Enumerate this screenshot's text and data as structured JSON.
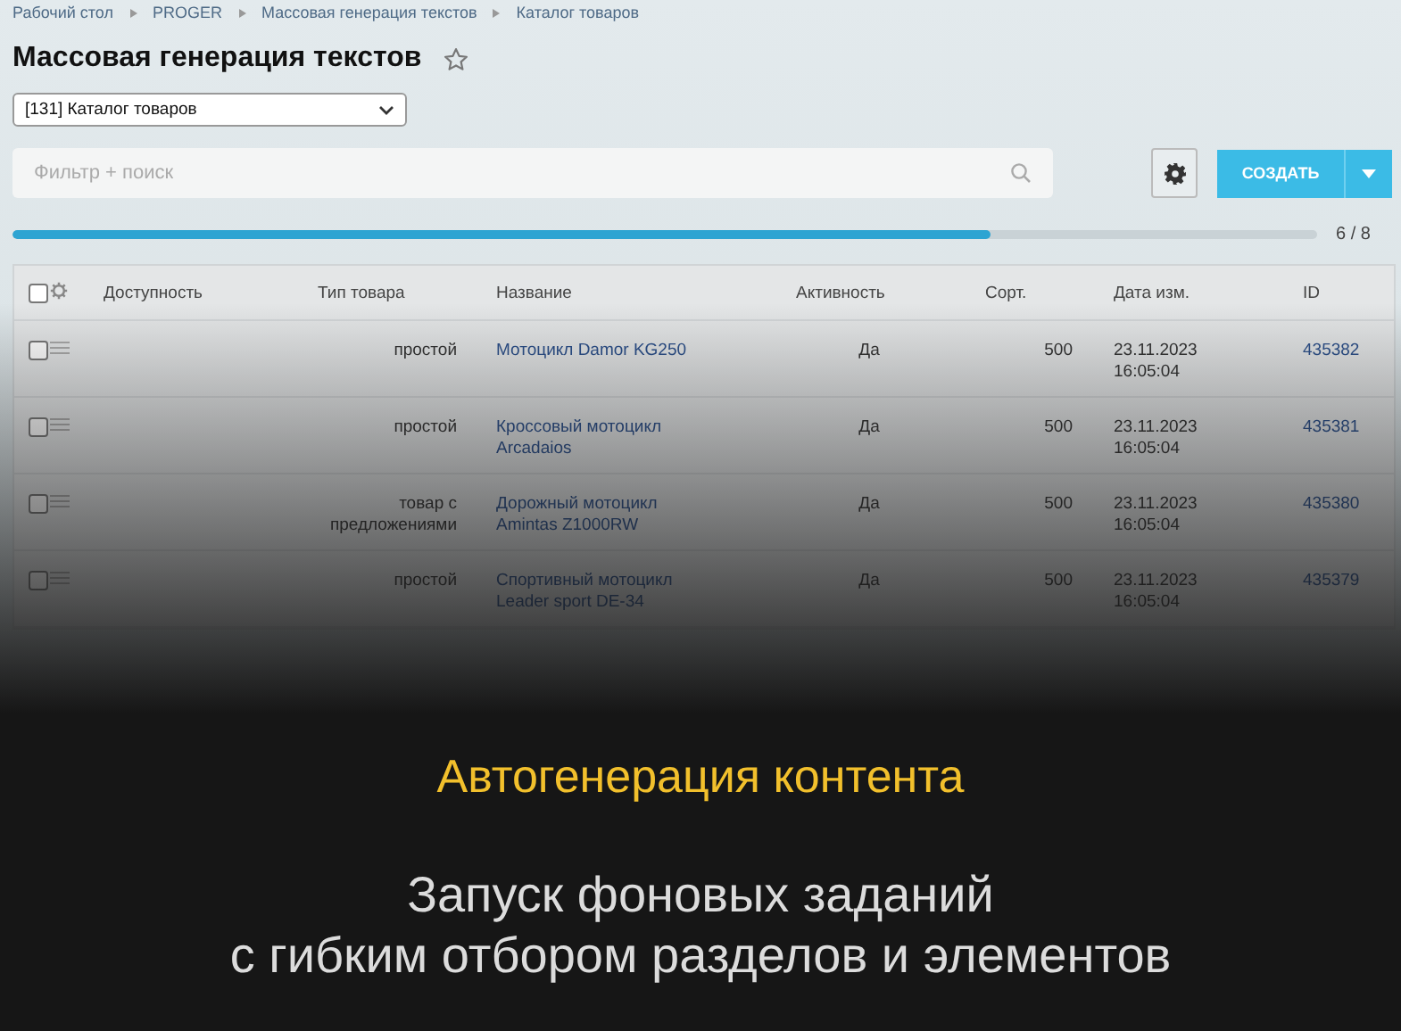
{
  "breadcrumbs": [
    "Рабочий стол",
    "PROGER",
    "Массовая генерация текстов",
    "Каталог товаров"
  ],
  "title": "Массовая генерация текстов",
  "favorite": false,
  "catalog_select": {
    "value": "[131] Каталог товаров"
  },
  "search": {
    "placeholder": "Фильтр + поиск"
  },
  "create_button": {
    "label": "СОЗДАТЬ"
  },
  "progress": {
    "level": 0.75,
    "reading": "6 / 8"
  },
  "table": {
    "select_all_checked": false,
    "columns": [
      "Доступность",
      "Тип товара",
      "Название",
      "Активность",
      "Сорт.",
      "Дата изм.",
      "ID"
    ],
    "rows": [
      {
        "checked": false,
        "type": "простой",
        "name": "Мотоцикл Damor KG250",
        "active": "Да",
        "sort": "500",
        "date": "23.11.2023",
        "time": "16:05:04",
        "id": "435382"
      },
      {
        "checked": false,
        "type": "простой",
        "name": "Кроссовый мотоцикл Arcadaios",
        "active": "Да",
        "sort": "500",
        "date": "23.11.2023",
        "time": "16:05:04",
        "id": "435381"
      },
      {
        "checked": false,
        "type": "товар с предложениями",
        "name": "Дорожный мотоцикл Amintas Z1000RW",
        "active": "Да",
        "sort": "500",
        "date": "23.11.2023",
        "time": "16:05:04",
        "id": "435380"
      },
      {
        "checked": false,
        "type": "простой",
        "name": "Спортивный мотоцикл Leader sport DE-34",
        "active": "Да",
        "sort": "500",
        "date": "23.11.2023",
        "time": "16:05:04",
        "id": "435379"
      }
    ]
  },
  "caption": {
    "headline": "Автогенерация контента",
    "lines": [
      "Запуск фоновых заданий",
      "с гибким отбором разделов и элементов"
    ]
  }
}
